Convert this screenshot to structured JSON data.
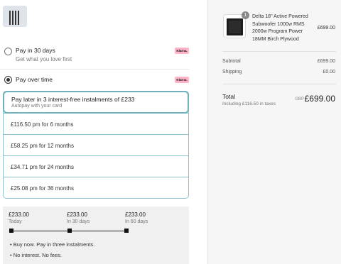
{
  "payment": {
    "logo_icon": "store-logo-icon",
    "options": [
      {
        "title": "Pay in 30 days",
        "subtitle": "Get what you love first",
        "badge": "Klarna.",
        "selected": false
      },
      {
        "title": "Pay over time",
        "badge": "Klarna.",
        "selected": true
      }
    ],
    "instalments": {
      "first": {
        "title": "Pay later in 3 interest-free instalments of £233",
        "subtitle": "Autopay with your card"
      },
      "options": [
        "£116.50 pm for 6 months",
        "£58.25 pm for 12 months",
        "£34.71 pm for 24 months",
        "£25.08 pm for 36 months"
      ]
    },
    "plan": {
      "steps": [
        {
          "amount": "£233.00",
          "when": "Today"
        },
        {
          "amount": "£233.00",
          "when": "In 30 days"
        },
        {
          "amount": "£233.00",
          "when": "In 60 days"
        }
      ],
      "bullets": [
        "Buy now. Pay in three instalments.",
        "No interest. No fees."
      ]
    }
  },
  "summary": {
    "product": {
      "quantity": "1",
      "name": "Delta 18\" Active Powered Subwoofer 1000w RMS 2000w Program Power 18MM Birch Plywood",
      "price": "£699.00",
      "image_icon": "subwoofer-image"
    },
    "subtotal_label": "Subtotal",
    "subtotal_value": "£699.00",
    "shipping_label": "Shipping",
    "shipping_value": "£0.00",
    "total_label": "Total",
    "tax_note": "Including £116.50 in taxes",
    "currency": "GBP",
    "total_value": "£699.00"
  },
  "colors": {
    "accent_border": "#6fb2bd",
    "klarna_pink": "#ffb3c7",
    "panel_bg": "#f6f6f6"
  }
}
